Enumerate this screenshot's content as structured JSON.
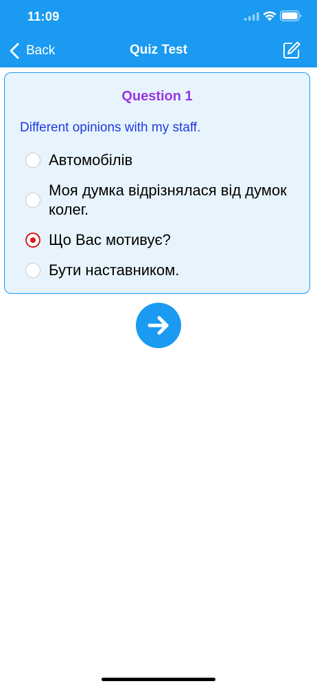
{
  "status_bar": {
    "time": "11:09"
  },
  "nav": {
    "back_label": "Back",
    "title": "Quiz Test",
    "edit_icon": "compose-icon"
  },
  "colors": {
    "header": "#1a9af0",
    "question_title": "#9b35e0",
    "question_text": "#1d3ae0",
    "selected_radio": "#e0141c",
    "card_background": "#e8f4fd"
  },
  "quiz": {
    "question_title": "Question 1",
    "question_text": "Different opinions with my staff.",
    "selected_index": 2,
    "options": [
      {
        "label": "Автомобілів",
        "selected": false
      },
      {
        "label": "Моя думка відрізнялася від думок колег.",
        "selected": false
      },
      {
        "label": "Що Вас мотивує?",
        "selected": true
      },
      {
        "label": "Бути наставником.",
        "selected": false
      }
    ]
  },
  "next_button_icon": "arrow-right-icon"
}
